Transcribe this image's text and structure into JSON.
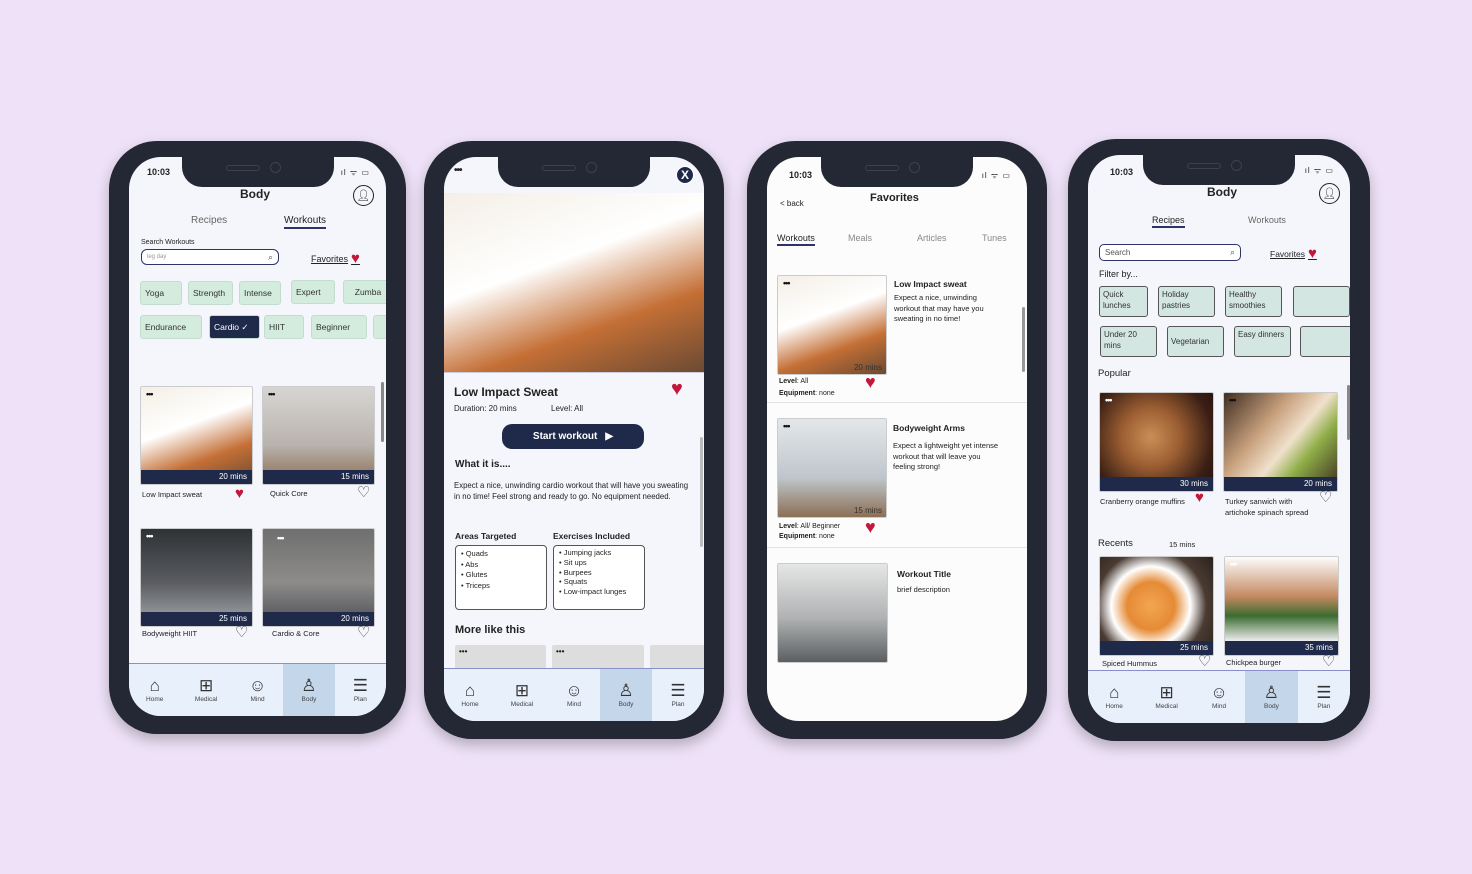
{
  "status": {
    "time": "10:03",
    "icons": "ıl ᯤ ▭"
  },
  "nav": [
    {
      "label": "Home",
      "icon": "home-icon"
    },
    {
      "label": "Medical",
      "icon": "medical-kit-icon"
    },
    {
      "label": "Mind",
      "icon": "brain-icon"
    },
    {
      "label": "Body",
      "icon": "body-icon"
    },
    {
      "label": "Plan",
      "icon": "plan-clipboard-icon"
    }
  ],
  "phone1": {
    "title": "Body",
    "tabs": [
      "Recipes",
      "Workouts"
    ],
    "active_tab": "Workouts",
    "search_label": "Search Workouts",
    "search_value": "leg day",
    "favorites": "Favorites",
    "chips_row1": [
      "Yoga",
      "Strength",
      "Intense",
      "Expert",
      "Zumba"
    ],
    "chips_row2": [
      "Endurance",
      "Cardio ✓",
      "HIIT",
      "Beginner",
      ""
    ],
    "selected_chip": "Cardio",
    "cards": [
      {
        "title": "Low Impact sweat",
        "duration": "20 mins",
        "favorite": true
      },
      {
        "title": "Quick Core",
        "duration": "15 mins",
        "favorite": false
      },
      {
        "title": "Bodyweight HIIT",
        "duration": "25 mins",
        "favorite": false
      },
      {
        "title": "Cardio & Core",
        "duration": "20 mins",
        "favorite": false
      }
    ],
    "more": "•••"
  },
  "phone2": {
    "title": "Low Impact Sweat",
    "duration": "Duration: 20 mins",
    "level": "Level: All",
    "start": "Start workout",
    "what_heading": "What it is....",
    "description": "Expect a nice, unwinding cardio workout that will have you sweating in no time! Feel strong and ready to go. No equipment needed.",
    "areas_heading": "Areas Targeted",
    "areas": [
      "Quads",
      "Abs",
      "Glutes",
      "Triceps"
    ],
    "exercises_heading": "Exercises Included",
    "exercises": [
      "Jumping jacks",
      "Sit ups",
      "Burpees",
      "Squats",
      "Low-impact lunges"
    ],
    "more_heading": "More like this",
    "close": "X",
    "menu": "•••",
    "favorite": true
  },
  "phone3": {
    "title": "Favorites",
    "back": "< back",
    "tabs": [
      "Workouts",
      "Meals",
      "Articles",
      "Tunes"
    ],
    "active_tab": "Workouts",
    "items": [
      {
        "title": "Low Impact sweat",
        "desc": "Expect a nice, unwinding workout that may have you sweating in no time!",
        "duration": "20 mins",
        "level_label": "Level",
        "level": ": All",
        "equip_label": "Equipment",
        "equip": ": none",
        "favorite": true
      },
      {
        "title": "Bodyweight Arms",
        "desc": "Expect a lightweight yet intense workout that will leave you feeling  strong!",
        "duration": "15 mins",
        "level_label": "Level",
        "level": ": All/ Beginner",
        "equip_label": "Equipment",
        "equip": ": none",
        "favorite": true
      },
      {
        "title": "Workout Title",
        "desc": "brief description"
      }
    ]
  },
  "phone4": {
    "title": "Body",
    "tabs": [
      "Recipes",
      "Workouts"
    ],
    "active_tab": "Recipes",
    "search_placeholder": "Search",
    "favorites": "Favorites",
    "filter_label": "Filter by...",
    "filters_row1": [
      "Quick lunches",
      "Holiday pastries",
      "Healthy smoothies",
      ""
    ],
    "filters_row2": [
      "Under 20 mins",
      "Vegetarian",
      "Easy dinners",
      ""
    ],
    "popular_label": "Popular",
    "popular": [
      {
        "title": "Cranberry orange muffins",
        "duration": "30 mins",
        "favorite": true
      },
      {
        "title": "Turkey sanwich with artichoke spinach spread",
        "duration": "20 mins",
        "favorite": false
      }
    ],
    "recents_label": "Recents",
    "recents_note": "15 mins",
    "recents": [
      {
        "title": "Spiced Hummus",
        "duration": "25 mins",
        "favorite": false
      },
      {
        "title": "Chickpea burger",
        "duration": "35 mins",
        "favorite": false
      }
    ]
  }
}
